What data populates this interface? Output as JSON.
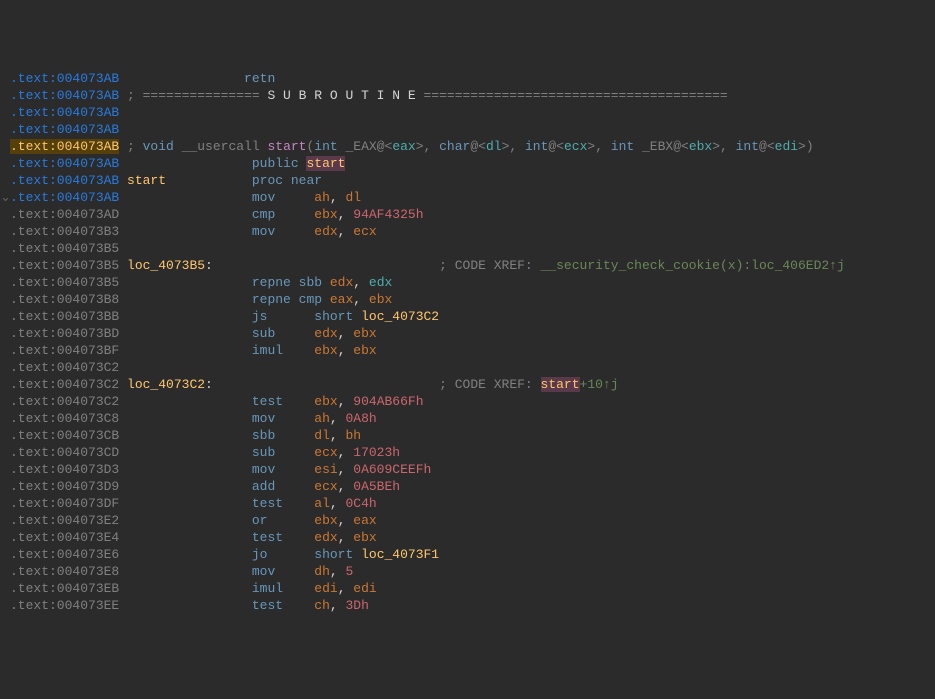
{
  "lines": [
    {
      "addr": ".text:004073AB",
      "addrClass": "addr-blue",
      "segments": [
        {
          "text": "                retn",
          "class": "c-blue"
        }
      ]
    },
    {
      "addr": ".text:004073AB",
      "addrClass": "addr-blue",
      "segments": [
        {
          "text": " ; =============== ",
          "class": "c-comment"
        },
        {
          "text": "S U B R O U T I N E",
          "class": "c-white"
        },
        {
          "text": " =======================================",
          "class": "c-comment"
        }
      ]
    },
    {
      "addr": ".text:004073AB",
      "addrClass": "addr-blue",
      "segments": []
    },
    {
      "addr": ".text:004073AB",
      "addrClass": "addr-blue",
      "segments": []
    },
    {
      "addr": ".text:004073AB",
      "addrClass": "addr-yellow",
      "segments": [
        {
          "text": " ; ",
          "class": "c-comment"
        },
        {
          "text": "void",
          "class": "c-blue"
        },
        {
          "text": " __usercall ",
          "class": "c-comment"
        },
        {
          "text": "start",
          "class": "c-magenta"
        },
        {
          "text": "(",
          "class": "c-comment"
        },
        {
          "text": "int",
          "class": "c-blue"
        },
        {
          "text": " _EAX@<",
          "class": "c-comment"
        },
        {
          "text": "eax",
          "class": "c-cyan"
        },
        {
          "text": ">, ",
          "class": "c-comment"
        },
        {
          "text": "char",
          "class": "c-blue"
        },
        {
          "text": "@<",
          "class": "c-comment"
        },
        {
          "text": "dl",
          "class": "c-cyan"
        },
        {
          "text": ">, ",
          "class": "c-comment"
        },
        {
          "text": "int",
          "class": "c-blue"
        },
        {
          "text": "@<",
          "class": "c-comment"
        },
        {
          "text": "ecx",
          "class": "c-cyan"
        },
        {
          "text": ">, ",
          "class": "c-comment"
        },
        {
          "text": "int",
          "class": "c-blue"
        },
        {
          "text": " _EBX@<",
          "class": "c-comment"
        },
        {
          "text": "ebx",
          "class": "c-cyan"
        },
        {
          "text": ">, ",
          "class": "c-comment"
        },
        {
          "text": "int",
          "class": "c-blue"
        },
        {
          "text": "@<",
          "class": "c-comment"
        },
        {
          "text": "edi",
          "class": "c-cyan"
        },
        {
          "text": ">)",
          "class": "c-comment"
        }
      ]
    },
    {
      "addr": ".text:004073AB",
      "addrClass": "addr-blue",
      "segments": [
        {
          "text": "                 ",
          "class": ""
        },
        {
          "text": "public",
          "class": "c-blue"
        },
        {
          "text": " ",
          "class": ""
        },
        {
          "text": "start",
          "class": "c-pinkbg"
        }
      ]
    },
    {
      "addr": ".text:004073AB",
      "addrClass": "addr-blue",
      "segments": [
        {
          "text": " ",
          "class": ""
        },
        {
          "text": "start",
          "class": "c-yellow"
        },
        {
          "text": "           ",
          "class": ""
        },
        {
          "text": "proc near",
          "class": "c-blue"
        }
      ]
    },
    {
      "gutter": "⌄",
      "addr": ".text:004073AB",
      "addrClass": "addr-blue",
      "segments": [
        {
          "text": "                 ",
          "class": ""
        },
        {
          "text": "mov",
          "class": "c-blue"
        },
        {
          "text": "     ",
          "class": ""
        },
        {
          "text": "ah",
          "class": "c-orange"
        },
        {
          "text": ", ",
          "class": "c-white"
        },
        {
          "text": "dl",
          "class": "c-orange"
        }
      ]
    },
    {
      "addr": ".text:004073AD",
      "addrClass": "addr-gray",
      "segments": [
        {
          "text": "                 ",
          "class": ""
        },
        {
          "text": "cmp",
          "class": "c-blue"
        },
        {
          "text": "     ",
          "class": ""
        },
        {
          "text": "ebx",
          "class": "c-orange"
        },
        {
          "text": ", ",
          "class": "c-white"
        },
        {
          "text": "94AF4325h",
          "class": "c-red"
        }
      ]
    },
    {
      "addr": ".text:004073B3",
      "addrClass": "addr-gray",
      "segments": [
        {
          "text": "                 ",
          "class": ""
        },
        {
          "text": "mov",
          "class": "c-blue"
        },
        {
          "text": "     ",
          "class": ""
        },
        {
          "text": "edx",
          "class": "c-orange"
        },
        {
          "text": ", ",
          "class": "c-white"
        },
        {
          "text": "ecx",
          "class": "c-orange"
        }
      ]
    },
    {
      "addr": ".text:004073B5",
      "addrClass": "addr-gray",
      "segments": []
    },
    {
      "addr": ".text:004073B5",
      "addrClass": "addr-gray",
      "segments": [
        {
          "text": " ",
          "class": ""
        },
        {
          "text": "loc_4073B5",
          "class": "c-yellow"
        },
        {
          "text": ":",
          "class": "c-white"
        },
        {
          "text": "                             ",
          "class": ""
        },
        {
          "text": "; CODE XREF: ",
          "class": "c-comment"
        },
        {
          "text": "__security_check_cookie(x):loc_406ED2↑j",
          "class": "c-green"
        }
      ]
    },
    {
      "addr": ".text:004073B5",
      "addrClass": "addr-gray",
      "segments": [
        {
          "text": "                 ",
          "class": ""
        },
        {
          "text": "repne sbb",
          "class": "c-blue"
        },
        {
          "text": " ",
          "class": ""
        },
        {
          "text": "edx",
          "class": "c-orange"
        },
        {
          "text": ", ",
          "class": "c-white"
        },
        {
          "text": "edx",
          "class": "c-cyan"
        }
      ]
    },
    {
      "addr": ".text:004073B8",
      "addrClass": "addr-gray",
      "segments": [
        {
          "text": "                 ",
          "class": ""
        },
        {
          "text": "repne cmp",
          "class": "c-blue"
        },
        {
          "text": " ",
          "class": ""
        },
        {
          "text": "eax",
          "class": "c-orange"
        },
        {
          "text": ", ",
          "class": "c-white"
        },
        {
          "text": "ebx",
          "class": "c-orange"
        }
      ]
    },
    {
      "addr": ".text:004073BB",
      "addrClass": "addr-gray",
      "segments": [
        {
          "text": "                 ",
          "class": ""
        },
        {
          "text": "js",
          "class": "c-blue"
        },
        {
          "text": "      ",
          "class": ""
        },
        {
          "text": "short",
          "class": "c-blue"
        },
        {
          "text": " ",
          "class": ""
        },
        {
          "text": "loc_4073C2",
          "class": "c-yellow"
        }
      ]
    },
    {
      "addr": ".text:004073BD",
      "addrClass": "addr-gray",
      "segments": [
        {
          "text": "                 ",
          "class": ""
        },
        {
          "text": "sub",
          "class": "c-blue"
        },
        {
          "text": "     ",
          "class": ""
        },
        {
          "text": "edx",
          "class": "c-orange"
        },
        {
          "text": ", ",
          "class": "c-white"
        },
        {
          "text": "ebx",
          "class": "c-orange"
        }
      ]
    },
    {
      "addr": ".text:004073BF",
      "addrClass": "addr-gray",
      "segments": [
        {
          "text": "                 ",
          "class": ""
        },
        {
          "text": "imul",
          "class": "c-blue"
        },
        {
          "text": "    ",
          "class": ""
        },
        {
          "text": "ebx",
          "class": "c-orange"
        },
        {
          "text": ", ",
          "class": "c-white"
        },
        {
          "text": "ebx",
          "class": "c-orange"
        }
      ]
    },
    {
      "addr": ".text:004073C2",
      "addrClass": "addr-gray",
      "segments": []
    },
    {
      "addr": ".text:004073C2",
      "addrClass": "addr-gray",
      "segments": [
        {
          "text": " ",
          "class": ""
        },
        {
          "text": "loc_4073C2",
          "class": "c-yellow"
        },
        {
          "text": ":",
          "class": "c-white"
        },
        {
          "text": "                             ",
          "class": ""
        },
        {
          "text": "; CODE XREF: ",
          "class": "c-comment"
        },
        {
          "text": "start",
          "class": "c-pinkbg"
        },
        {
          "text": "+10↑j",
          "class": "c-green"
        }
      ]
    },
    {
      "addr": ".text:004073C2",
      "addrClass": "addr-gray",
      "segments": [
        {
          "text": "                 ",
          "class": ""
        },
        {
          "text": "test",
          "class": "c-blue"
        },
        {
          "text": "    ",
          "class": ""
        },
        {
          "text": "ebx",
          "class": "c-orange"
        },
        {
          "text": ", ",
          "class": "c-white"
        },
        {
          "text": "904AB66Fh",
          "class": "c-red"
        }
      ]
    },
    {
      "addr": ".text:004073C8",
      "addrClass": "addr-gray",
      "segments": [
        {
          "text": "                 ",
          "class": ""
        },
        {
          "text": "mov",
          "class": "c-blue"
        },
        {
          "text": "     ",
          "class": ""
        },
        {
          "text": "ah",
          "class": "c-orange"
        },
        {
          "text": ", ",
          "class": "c-white"
        },
        {
          "text": "0A8h",
          "class": "c-red"
        }
      ]
    },
    {
      "addr": ".text:004073CB",
      "addrClass": "addr-gray",
      "segments": [
        {
          "text": "                 ",
          "class": ""
        },
        {
          "text": "sbb",
          "class": "c-blue"
        },
        {
          "text": "     ",
          "class": ""
        },
        {
          "text": "dl",
          "class": "c-orange"
        },
        {
          "text": ", ",
          "class": "c-white"
        },
        {
          "text": "bh",
          "class": "c-orange"
        }
      ]
    },
    {
      "addr": ".text:004073CD",
      "addrClass": "addr-gray",
      "segments": [
        {
          "text": "                 ",
          "class": ""
        },
        {
          "text": "sub",
          "class": "c-blue"
        },
        {
          "text": "     ",
          "class": ""
        },
        {
          "text": "ecx",
          "class": "c-orange"
        },
        {
          "text": ", ",
          "class": "c-white"
        },
        {
          "text": "17023h",
          "class": "c-red"
        }
      ]
    },
    {
      "addr": ".text:004073D3",
      "addrClass": "addr-gray",
      "segments": [
        {
          "text": "                 ",
          "class": ""
        },
        {
          "text": "mov",
          "class": "c-blue"
        },
        {
          "text": "     ",
          "class": ""
        },
        {
          "text": "esi",
          "class": "c-orange"
        },
        {
          "text": ", ",
          "class": "c-white"
        },
        {
          "text": "0A609CEEFh",
          "class": "c-red"
        }
      ]
    },
    {
      "addr": ".text:004073D9",
      "addrClass": "addr-gray",
      "segments": [
        {
          "text": "                 ",
          "class": ""
        },
        {
          "text": "add",
          "class": "c-blue"
        },
        {
          "text": "     ",
          "class": ""
        },
        {
          "text": "ecx",
          "class": "c-orange"
        },
        {
          "text": ", ",
          "class": "c-white"
        },
        {
          "text": "0A5BEh",
          "class": "c-red"
        }
      ]
    },
    {
      "addr": ".text:004073DF",
      "addrClass": "addr-gray",
      "segments": [
        {
          "text": "                 ",
          "class": ""
        },
        {
          "text": "test",
          "class": "c-blue"
        },
        {
          "text": "    ",
          "class": ""
        },
        {
          "text": "al",
          "class": "c-orange"
        },
        {
          "text": ", ",
          "class": "c-white"
        },
        {
          "text": "0C4h",
          "class": "c-red"
        }
      ]
    },
    {
      "addr": ".text:004073E2",
      "addrClass": "addr-gray",
      "segments": [
        {
          "text": "                 ",
          "class": ""
        },
        {
          "text": "or",
          "class": "c-blue"
        },
        {
          "text": "      ",
          "class": ""
        },
        {
          "text": "ebx",
          "class": "c-orange"
        },
        {
          "text": ", ",
          "class": "c-white"
        },
        {
          "text": "eax",
          "class": "c-orange"
        }
      ]
    },
    {
      "addr": ".text:004073E4",
      "addrClass": "addr-gray",
      "segments": [
        {
          "text": "                 ",
          "class": ""
        },
        {
          "text": "test",
          "class": "c-blue"
        },
        {
          "text": "    ",
          "class": ""
        },
        {
          "text": "edx",
          "class": "c-orange"
        },
        {
          "text": ", ",
          "class": "c-white"
        },
        {
          "text": "ebx",
          "class": "c-orange"
        }
      ]
    },
    {
      "addr": ".text:004073E6",
      "addrClass": "addr-gray",
      "segments": [
        {
          "text": "                 ",
          "class": ""
        },
        {
          "text": "jo",
          "class": "c-blue"
        },
        {
          "text": "      ",
          "class": ""
        },
        {
          "text": "short",
          "class": "c-blue"
        },
        {
          "text": " ",
          "class": ""
        },
        {
          "text": "loc_4073F1",
          "class": "c-yellow"
        }
      ]
    },
    {
      "addr": ".text:004073E8",
      "addrClass": "addr-gray",
      "segments": [
        {
          "text": "                 ",
          "class": ""
        },
        {
          "text": "mov",
          "class": "c-blue"
        },
        {
          "text": "     ",
          "class": ""
        },
        {
          "text": "dh",
          "class": "c-orange"
        },
        {
          "text": ", ",
          "class": "c-white"
        },
        {
          "text": "5",
          "class": "c-red"
        }
      ]
    },
    {
      "addr": ".text:004073EB",
      "addrClass": "addr-gray",
      "segments": [
        {
          "text": "                 ",
          "class": ""
        },
        {
          "text": "imul",
          "class": "c-blue"
        },
        {
          "text": "    ",
          "class": ""
        },
        {
          "text": "edi",
          "class": "c-orange"
        },
        {
          "text": ", ",
          "class": "c-white"
        },
        {
          "text": "edi",
          "class": "c-orange"
        }
      ]
    },
    {
      "addr": ".text:004073EE",
      "addrClass": "addr-gray",
      "segments": [
        {
          "text": "                 ",
          "class": ""
        },
        {
          "text": "test",
          "class": "c-blue"
        },
        {
          "text": "    ",
          "class": ""
        },
        {
          "text": "ch",
          "class": "c-orange"
        },
        {
          "text": ", ",
          "class": "c-white"
        },
        {
          "text": "3Dh",
          "class": "c-red"
        }
      ]
    }
  ]
}
